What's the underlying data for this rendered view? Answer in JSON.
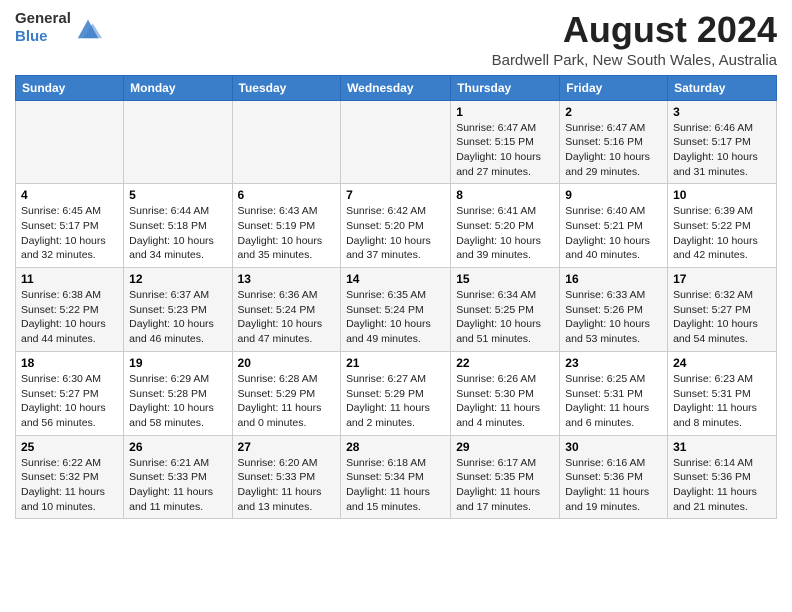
{
  "header": {
    "logo": {
      "general": "General",
      "blue": "Blue"
    },
    "title": "August 2024",
    "subtitle": "Bardwell Park, New South Wales, Australia"
  },
  "calendar": {
    "columns": [
      "Sunday",
      "Monday",
      "Tuesday",
      "Wednesday",
      "Thursday",
      "Friday",
      "Saturday"
    ],
    "weeks": [
      [
        {
          "day": "",
          "info": ""
        },
        {
          "day": "",
          "info": ""
        },
        {
          "day": "",
          "info": ""
        },
        {
          "day": "",
          "info": ""
        },
        {
          "day": "1",
          "info": "Sunrise: 6:47 AM\nSunset: 5:15 PM\nDaylight: 10 hours\nand 27 minutes."
        },
        {
          "day": "2",
          "info": "Sunrise: 6:47 AM\nSunset: 5:16 PM\nDaylight: 10 hours\nand 29 minutes."
        },
        {
          "day": "3",
          "info": "Sunrise: 6:46 AM\nSunset: 5:17 PM\nDaylight: 10 hours\nand 31 minutes."
        }
      ],
      [
        {
          "day": "4",
          "info": "Sunrise: 6:45 AM\nSunset: 5:17 PM\nDaylight: 10 hours\nand 32 minutes."
        },
        {
          "day": "5",
          "info": "Sunrise: 6:44 AM\nSunset: 5:18 PM\nDaylight: 10 hours\nand 34 minutes."
        },
        {
          "day": "6",
          "info": "Sunrise: 6:43 AM\nSunset: 5:19 PM\nDaylight: 10 hours\nand 35 minutes."
        },
        {
          "day": "7",
          "info": "Sunrise: 6:42 AM\nSunset: 5:20 PM\nDaylight: 10 hours\nand 37 minutes."
        },
        {
          "day": "8",
          "info": "Sunrise: 6:41 AM\nSunset: 5:20 PM\nDaylight: 10 hours\nand 39 minutes."
        },
        {
          "day": "9",
          "info": "Sunrise: 6:40 AM\nSunset: 5:21 PM\nDaylight: 10 hours\nand 40 minutes."
        },
        {
          "day": "10",
          "info": "Sunrise: 6:39 AM\nSunset: 5:22 PM\nDaylight: 10 hours\nand 42 minutes."
        }
      ],
      [
        {
          "day": "11",
          "info": "Sunrise: 6:38 AM\nSunset: 5:22 PM\nDaylight: 10 hours\nand 44 minutes."
        },
        {
          "day": "12",
          "info": "Sunrise: 6:37 AM\nSunset: 5:23 PM\nDaylight: 10 hours\nand 46 minutes."
        },
        {
          "day": "13",
          "info": "Sunrise: 6:36 AM\nSunset: 5:24 PM\nDaylight: 10 hours\nand 47 minutes."
        },
        {
          "day": "14",
          "info": "Sunrise: 6:35 AM\nSunset: 5:24 PM\nDaylight: 10 hours\nand 49 minutes."
        },
        {
          "day": "15",
          "info": "Sunrise: 6:34 AM\nSunset: 5:25 PM\nDaylight: 10 hours\nand 51 minutes."
        },
        {
          "day": "16",
          "info": "Sunrise: 6:33 AM\nSunset: 5:26 PM\nDaylight: 10 hours\nand 53 minutes."
        },
        {
          "day": "17",
          "info": "Sunrise: 6:32 AM\nSunset: 5:27 PM\nDaylight: 10 hours\nand 54 minutes."
        }
      ],
      [
        {
          "day": "18",
          "info": "Sunrise: 6:30 AM\nSunset: 5:27 PM\nDaylight: 10 hours\nand 56 minutes."
        },
        {
          "day": "19",
          "info": "Sunrise: 6:29 AM\nSunset: 5:28 PM\nDaylight: 10 hours\nand 58 minutes."
        },
        {
          "day": "20",
          "info": "Sunrise: 6:28 AM\nSunset: 5:29 PM\nDaylight: 11 hours\nand 0 minutes."
        },
        {
          "day": "21",
          "info": "Sunrise: 6:27 AM\nSunset: 5:29 PM\nDaylight: 11 hours\nand 2 minutes."
        },
        {
          "day": "22",
          "info": "Sunrise: 6:26 AM\nSunset: 5:30 PM\nDaylight: 11 hours\nand 4 minutes."
        },
        {
          "day": "23",
          "info": "Sunrise: 6:25 AM\nSunset: 5:31 PM\nDaylight: 11 hours\nand 6 minutes."
        },
        {
          "day": "24",
          "info": "Sunrise: 6:23 AM\nSunset: 5:31 PM\nDaylight: 11 hours\nand 8 minutes."
        }
      ],
      [
        {
          "day": "25",
          "info": "Sunrise: 6:22 AM\nSunset: 5:32 PM\nDaylight: 11 hours\nand 10 minutes."
        },
        {
          "day": "26",
          "info": "Sunrise: 6:21 AM\nSunset: 5:33 PM\nDaylight: 11 hours\nand 11 minutes."
        },
        {
          "day": "27",
          "info": "Sunrise: 6:20 AM\nSunset: 5:33 PM\nDaylight: 11 hours\nand 13 minutes."
        },
        {
          "day": "28",
          "info": "Sunrise: 6:18 AM\nSunset: 5:34 PM\nDaylight: 11 hours\nand 15 minutes."
        },
        {
          "day": "29",
          "info": "Sunrise: 6:17 AM\nSunset: 5:35 PM\nDaylight: 11 hours\nand 17 minutes."
        },
        {
          "day": "30",
          "info": "Sunrise: 6:16 AM\nSunset: 5:36 PM\nDaylight: 11 hours\nand 19 minutes."
        },
        {
          "day": "31",
          "info": "Sunrise: 6:14 AM\nSunset: 5:36 PM\nDaylight: 11 hours\nand 21 minutes."
        }
      ]
    ]
  }
}
